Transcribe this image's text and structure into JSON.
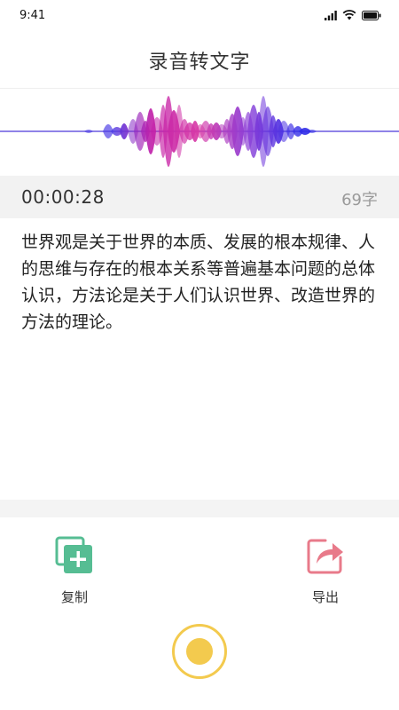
{
  "status": {
    "time": "9:41",
    "icons": [
      "cellular-signal-icon",
      "wifi-icon",
      "battery-icon"
    ]
  },
  "header": {
    "title": "录音转文字"
  },
  "recording": {
    "elapsed": "00:00:28",
    "char_count": "69字"
  },
  "transcript": {
    "text": "世界观是关于世界的本质、发展的根本规律、人的思维与存在的根本关系等普遍基本问题的总体认识，方法论是关于人们认识世界、改造世界的方法的理论。"
  },
  "actions": {
    "copy_label": "复制",
    "copy_icon": "copy-icon",
    "export_label": "导出",
    "export_icon": "export-icon"
  },
  "record_button": {
    "icon": "record-icon",
    "color": "#f3ca4e"
  },
  "colors": {
    "copy_green": "#56bd93",
    "export_pink": "#e87a8a",
    "wave_blue": "#3b2ee0",
    "wave_magenta": "#c01aa5"
  }
}
